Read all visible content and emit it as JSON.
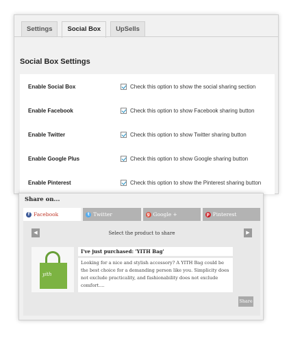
{
  "settings": {
    "tabs": [
      {
        "label": "Settings"
      },
      {
        "label": "Social Box"
      },
      {
        "label": "UpSells"
      }
    ],
    "section_title": "Social Box Settings",
    "rows": [
      {
        "label": "Enable Social Box",
        "checked": true,
        "description": "Check this option to show the social sharing section"
      },
      {
        "label": "Enable Facebook",
        "checked": true,
        "description": "Check this option to show Facebook sharing button"
      },
      {
        "label": "Enable Twitter",
        "checked": true,
        "description": "Check this option to show Twitter sharing button"
      },
      {
        "label": "Enable Google Plus",
        "checked": true,
        "description": "Check this option to show Google sharing button"
      },
      {
        "label": "Enable Pinterest",
        "checked": true,
        "description": "Check this option to show the Pinterest sharing button"
      }
    ]
  },
  "share": {
    "heading": "Share on...",
    "tabs": [
      {
        "label": "Facebook",
        "icon": "facebook-icon",
        "color": "#3b5998"
      },
      {
        "label": "Twitter",
        "icon": "twitter-icon",
        "color": "#55acee"
      },
      {
        "label": "Google +",
        "icon": "google-plus-icon",
        "color": "#dd4b39"
      },
      {
        "label": "Pinterest",
        "icon": "pinterest-icon",
        "color": "#cb2027"
      }
    ],
    "prev_arrow": "◀",
    "next_arrow": "▶",
    "select_label": "Select the product to share",
    "product": {
      "image_text": "yith",
      "title": "I've just purchased: 'YITH Bag'",
      "description": "Looking for a nice and stylish accessory? A YITH Bag could be the best choice for a demanding person like you. Simplicity does not exclude practicality, and fashionability does not exclude comfort...."
    },
    "share_button": "Share"
  }
}
